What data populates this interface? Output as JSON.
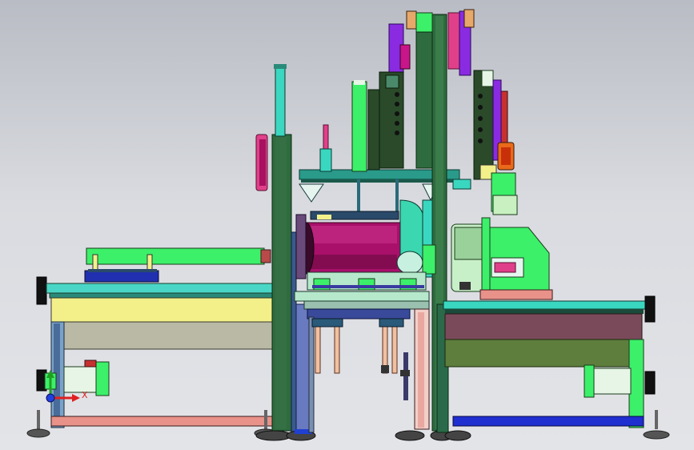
{
  "viewport": {
    "background_top": "#b9bcc4",
    "background_bottom": "#e3e4e8"
  },
  "triad": {
    "x_label": "X",
    "y_label": "",
    "x_color": "#e02020",
    "y_color": "#20a020",
    "origin_color": "#2040e0"
  },
  "palette": {
    "frame_green": "#2e6b3e",
    "frame_dark": "#1f4a2a",
    "cyan": "#39d3c4",
    "lime": "#3cf06a",
    "magenta": "#c8168a",
    "purple": "#7a1a8a",
    "violet": "#8a2be2",
    "yellow": "#f3f08a",
    "salmon": "#e8928a",
    "blue": "#1f2fd0",
    "orange": "#e86a1a",
    "olive": "#5e7e3e",
    "maroon": "#7a4a5a",
    "grey_panel": "#b8b8a8"
  }
}
